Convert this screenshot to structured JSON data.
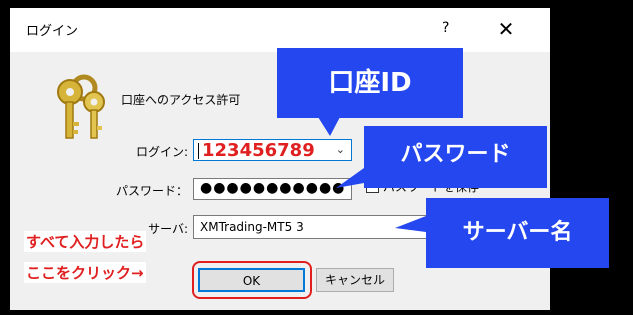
{
  "window": {
    "title": "ログイン",
    "help_label": "?",
    "close_label": "✕"
  },
  "header": {
    "access_label": "口座へのアクセス許可"
  },
  "form": {
    "login_label": "ログイン:",
    "login_value": "123456789",
    "password_label": "パスワード：",
    "password_value": "●●●●●●●●●●●",
    "save_password_label": "パスワードを保存",
    "save_password_checked": true,
    "server_label": "サーバ:",
    "server_value": "XMTrading-MT5 3"
  },
  "buttons": {
    "ok_label": "OK",
    "cancel_label": "キャンセル"
  },
  "annotations": {
    "callout_account_id": "口座ID",
    "callout_password": "パスワード",
    "callout_server": "サーバー名",
    "instruction_line1": "すべて入力したら",
    "instruction_line2": "ここをクリック→",
    "callout_color": "#2547f0",
    "highlight_color": "#e02020"
  },
  "icons": {
    "keys": "keys-icon",
    "dropdown": "chevron-down-icon"
  }
}
